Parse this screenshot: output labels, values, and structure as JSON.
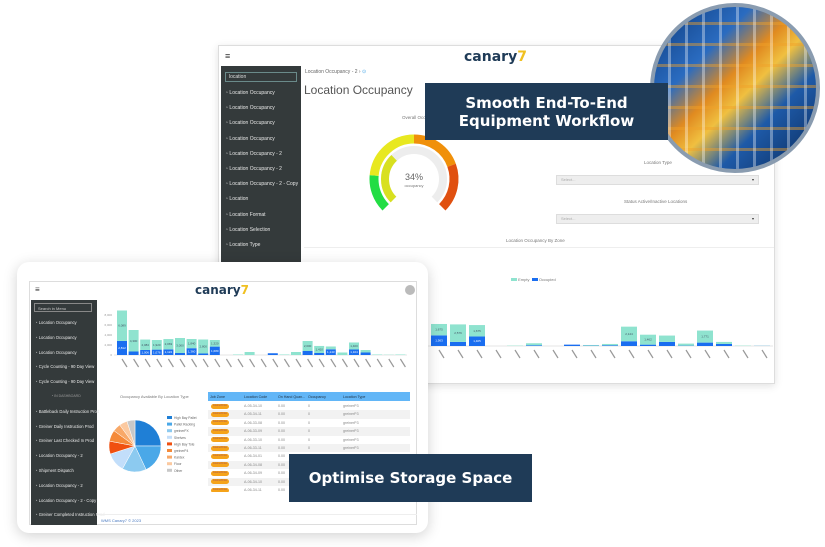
{
  "back_app": {
    "brand": "canary",
    "breadcrumb": "Location Occupancy - 2",
    "search_value": "location",
    "menu": [
      "Location Occupancy",
      "Location Occupancy",
      "Location Occupancy",
      "Location Occupancy",
      "Location Occupancy - 2",
      "Location Occupancy - 2",
      "Location Occupancy - 2 - Copy",
      "Location",
      "Location Format",
      "Location Selection",
      "Location Type"
    ],
    "page_title": "Location Occupancy",
    "overall_label": "Overall Occupancy",
    "gauge_value": "34%",
    "gauge_caption": "occupancy",
    "gauge_percent": 34,
    "filters": [
      {
        "label": "Location Type",
        "placeholder": "Select..."
      },
      {
        "label": "Status Active/Inactive Locations",
        "placeholder": "Select..."
      }
    ],
    "zone_chart_title": "Location Occupancy By Zone",
    "legend": [
      "Empty",
      "Occupied"
    ],
    "bars": {
      "empty": [
        1675,
        2576,
        1675,
        0,
        50,
        300,
        0,
        0,
        100,
        200,
        2144,
        1462,
        934,
        300,
        1771,
        300,
        50,
        20
      ],
      "occupied": [
        1563,
        600,
        1405,
        0,
        0,
        100,
        0,
        200,
        50,
        100,
        700,
        200,
        600,
        50,
        500,
        300,
        0,
        20
      ]
    }
  },
  "front_app": {
    "brand": "canary",
    "search_placeholder": "Search in Menu",
    "menu": [
      "Location Occupancy",
      "Location Occupancy",
      "Location Occupancy",
      "Cycle Counting - 90 Day View",
      "Cycle Counting - 90 Day View",
      "IN DASHBOARD",
      "Battleback Daily Instruction Prod",
      "Greiner Daily Instruction Prod",
      "Greiner Last Checked In Prod",
      "Location Occupancy - 2",
      "Shipment Dispatch",
      "Location Occupancy - 2",
      "Location Occupancy - 2 - Copy",
      "Greiner Completed Instruction Prod"
    ],
    "y_ticks": [
      "0",
      "2,000",
      "4,000",
      "6,000",
      "8,000"
    ],
    "bars": {
      "empty": [
        6089,
        4300,
        2084,
        1920,
        2069,
        3000,
        1840,
        2800,
        1320,
        0,
        100,
        600,
        0,
        0,
        100,
        600,
        2000,
        1410,
        560,
        500,
        1400,
        500,
        100,
        50,
        100
      ],
      "occupied": [
        2812,
        700,
        1006,
        1076,
        1122,
        400,
        1360,
        300,
        1680,
        0,
        0,
        0,
        0,
        350,
        0,
        0,
        800,
        400,
        1143,
        0,
        1104,
        500,
        0,
        0,
        0
      ]
    },
    "pie_title": "Occupancy Available By Location Type",
    "pie": [
      {
        "name": "High Bay Pallet",
        "value": 25,
        "color": "#1f7fd6"
      },
      {
        "name": "Pallet Racking",
        "value": 18,
        "color": "#4aa8e8"
      },
      {
        "name": "greinerPX",
        "value": 15,
        "color": "#8ccaf0"
      },
      {
        "name": "Shelves",
        "value": 12,
        "color": "#c2defa"
      },
      {
        "name": "High Bay Tote",
        "value": 8,
        "color": "#f05010"
      },
      {
        "name": "greinerP4",
        "value": 7,
        "color": "#f58a3a"
      },
      {
        "name": "Kardex",
        "value": 5,
        "color": "#f8a868"
      },
      {
        "name": "Floor",
        "value": 5,
        "color": "#fbc9a0"
      },
      {
        "name": "Other",
        "value": 5,
        "color": "#c8c8c8"
      }
    ],
    "table": {
      "columns": [
        "Job Zone",
        "Location Code",
        "On Hand Quan...",
        "Occupancy",
        "Location Type"
      ],
      "rows": [
        [
          "GreinerDrive",
          "A-05-34-10",
          "0.00",
          "0",
          "greinerP3"
        ],
        [
          "GreinerDrive",
          "A-05-34-11",
          "0.00",
          "0",
          "greinerP3"
        ],
        [
          "GreinerDrive",
          "A-06-33-08",
          "0.00",
          "0",
          "greinerP3"
        ],
        [
          "GreinerDrive",
          "A-06-33-09",
          "0.00",
          "0",
          "greinerP3"
        ],
        [
          "GreinerDrive",
          "A-06-33-10",
          "0.00",
          "0",
          "greinerP3"
        ],
        [
          "GreinerDrive",
          "A-06-33-11",
          "0.00",
          "0",
          "greinerP3"
        ],
        [
          "GreinerDrive",
          "A-06-34-01",
          "0.00",
          "0",
          "greinerP3"
        ],
        [
          "GreinerDrive",
          "A-06-34-08",
          "0.00",
          "0",
          "greinerP3"
        ],
        [
          "GreinerDrive",
          "A-06-34-09",
          "0.00",
          "0",
          "greinerP3"
        ],
        [
          "GreinerDrive",
          "A-06-34-10",
          "0.00",
          "0",
          "greinerP3"
        ],
        [
          "GreinerDrive",
          "A-06-34-11",
          "0.00",
          "0",
          "greinerP3"
        ]
      ]
    },
    "footer": "WMS Canary7 © 2023"
  },
  "banners": {
    "top": "Smooth End-To-End Equipment Workflow",
    "bottom": "Optimise Storage Space"
  },
  "colors": {
    "navy": "#1f3b57",
    "empty": "#8fe3cf",
    "occupied": "#1a6ef0",
    "table_header": "#62b6f7",
    "sidebar": "#343a3b"
  }
}
